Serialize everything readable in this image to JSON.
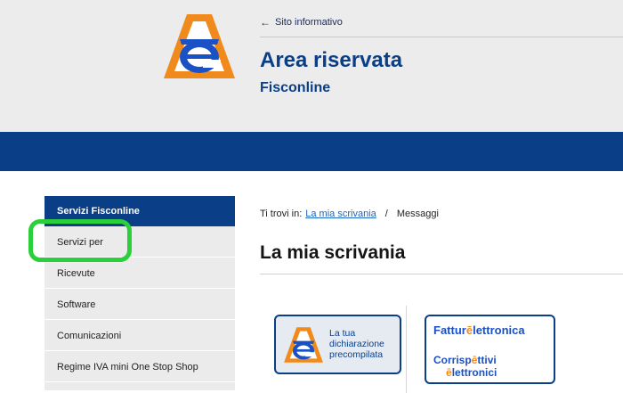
{
  "header": {
    "back_link": "Sito informativo",
    "title": "Area riservata",
    "subtitle": "Fisconline"
  },
  "sidebar": {
    "heading": "Servizi Fisconline",
    "items": [
      {
        "label": "Servizi per"
      },
      {
        "label": "Ricevute"
      },
      {
        "label": "Software"
      },
      {
        "label": "Comunicazioni"
      },
      {
        "label": "Regime IVA mini One Stop Shop"
      }
    ]
  },
  "breadcrumb": {
    "prefix": "Ti trovi in:",
    "link": "La mia scrivania",
    "separator": "/",
    "current": "Messaggi"
  },
  "main": {
    "heading": "La mia scrivania",
    "cards": [
      {
        "label_lines": [
          "La tua",
          "dichiarazione",
          "precompilata"
        ]
      },
      {
        "line1_a": "Fattur",
        "line1_b": "lettronica",
        "line2_a": "Corrisp",
        "line2_b": "ttivi",
        "line2_c": "lettronici"
      }
    ]
  },
  "colors": {
    "brand_blue": "#0a3f87",
    "brand_orange": "#f08a1c",
    "highlight_green": "#2ad03a"
  }
}
